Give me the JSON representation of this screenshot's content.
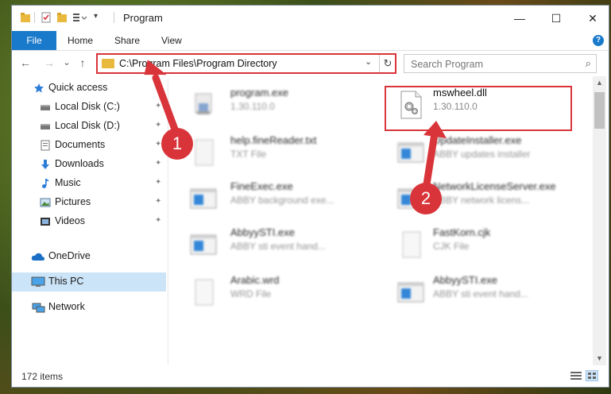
{
  "window": {
    "title": "Program",
    "controls": {
      "minimize": "—",
      "maximize": "☐",
      "close": "✕"
    }
  },
  "ribbon": {
    "tabs": [
      "File",
      "Home",
      "Share",
      "View"
    ],
    "help": "?"
  },
  "nav": {
    "back": "←",
    "forward": "→",
    "recent": "⌄",
    "up": "↑",
    "address": "C:\\Program Files\\Program Directory",
    "address_dropdown": "⌄",
    "refresh": "↻",
    "search_placeholder": "Search Program",
    "search_icon": "⌕"
  },
  "sidebar": {
    "items": [
      {
        "label": "Quick access",
        "icon": "star-icon",
        "pinned": false
      },
      {
        "label": "Local Disk (C:)",
        "icon": "drive-icon",
        "pinned": true
      },
      {
        "label": "Local Disk (D:)",
        "icon": "drive-icon",
        "pinned": true
      },
      {
        "label": "Documents",
        "icon": "documents-icon",
        "pinned": true
      },
      {
        "label": "Downloads",
        "icon": "download-icon",
        "pinned": true
      },
      {
        "label": "Music",
        "icon": "music-icon",
        "pinned": true
      },
      {
        "label": "Pictures",
        "icon": "pictures-icon",
        "pinned": true
      },
      {
        "label": "Videos",
        "icon": "videos-icon",
        "pinned": true
      },
      {
        "label": "OneDrive",
        "icon": "cloud-icon",
        "pinned": false
      },
      {
        "label": "This PC",
        "icon": "computer-icon",
        "pinned": false,
        "selected": true
      },
      {
        "label": "Network",
        "icon": "network-icon",
        "pinned": false
      }
    ],
    "pin_glyph": "📌"
  },
  "files": [
    {
      "name": "program.exe",
      "sub": "1.30.110.0",
      "icon": "installer-icon"
    },
    {
      "name": "mswheel.dll",
      "sub": "1.30.110.0",
      "icon": "dll-gear-icon",
      "highlighted": true
    },
    {
      "name": "help.fineReader.txt",
      "sub": "TXT File",
      "icon": "text-file-icon"
    },
    {
      "name": "UpdateInstaller.exe",
      "sub": "ABBY updates installer",
      "icon": "window-app-icon"
    },
    {
      "name": "FineExec.exe",
      "sub": "ABBY background exe...",
      "icon": "window-app-icon"
    },
    {
      "name": "NetworkLicenseServer.exe",
      "sub": "ABBY network licens...",
      "icon": "window-app-icon"
    },
    {
      "name": "AbbyySTI.exe",
      "sub": "ABBY sti event hand...",
      "icon": "window-app-icon"
    },
    {
      "name": "FastKorn.cjk",
      "sub": "CJK File",
      "icon": "blank-file-icon"
    },
    {
      "name": "Arabic.wrd",
      "sub": "WRD File",
      "icon": "blank-file-icon"
    },
    {
      "name": "AbbyySTI.exe",
      "sub": "ABBY sti event hand...",
      "icon": "window-app-icon"
    }
  ],
  "status": {
    "count": "172 items"
  },
  "annotations": {
    "badge1": "1",
    "badge2": "2",
    "color": "#d9343a"
  },
  "colors": {
    "accent": "#1979ca",
    "selection": "#cce4f7",
    "highlight": "#d9343a"
  }
}
